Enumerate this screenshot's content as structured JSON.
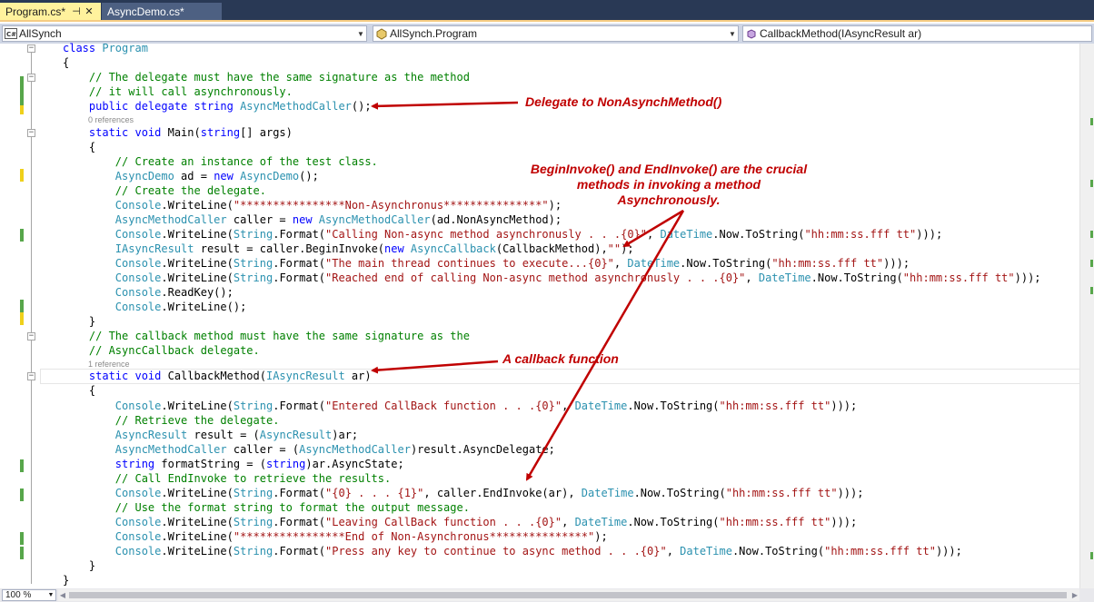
{
  "tabs": [
    {
      "label": "Program.cs*",
      "active": true
    },
    {
      "label": "AsyncDemo.cs*",
      "active": false
    }
  ],
  "nav": {
    "project": "AllSynch",
    "type": "AllSynch.Program",
    "member": "CallbackMethod(IAsyncResult ar)"
  },
  "code": {
    "l1": {
      "a": "class ",
      "b": "Program"
    },
    "l2": {
      "a": "{"
    },
    "l3": {
      "a": "    // The delegate must have the same signature as the method"
    },
    "l4": {
      "a": "    // it will call asynchronously."
    },
    "l5": {
      "a": "    public delegate string ",
      "b": "AsyncMethodCaller",
      "c": "();"
    },
    "r1": "0 references",
    "l6": {
      "a": "    static void ",
      "b": "Main(",
      "c": "string",
      "d": "[] args)"
    },
    "l7": {
      "a": "    {"
    },
    "l8": {
      "a": "        // Create an instance of the test class."
    },
    "l9": {
      "a": "        ",
      "b": "AsyncDemo",
      "c": " ad = ",
      "d": "new ",
      "e": "AsyncDemo",
      "f": "();"
    },
    "l10": {
      "a": "        // Create the delegate."
    },
    "l11": {
      "a": "        ",
      "b": "Console",
      "c": ".WriteLine(",
      "d": "\"****************Non-Asynchronus***************\"",
      "e": ");"
    },
    "l12": {
      "a": "        ",
      "b": "AsyncMethodCaller",
      "c": " caller = ",
      "d": "new ",
      "e": "AsyncMethodCaller",
      "f": "(ad.NonAsyncMethod);"
    },
    "l13": {
      "a": "        ",
      "b": "Console",
      "c": ".WriteLine(",
      "d": "String",
      "e": ".Format(",
      "f": "\"Calling Non-async method asynchronusly . . .{0}\"",
      "g": ", ",
      "h": "DateTime",
      "i": ".Now.ToString(",
      "j": "\"hh:mm:ss.fff tt\"",
      "k": ")));"
    },
    "l14": {
      "a": "        ",
      "b": "IAsyncResult",
      "c": " result = caller.BeginInvoke(",
      "d": "new ",
      "e": "AsyncCallback",
      "f": "(CallbackMethod),",
      "g": "\"\"",
      "h": ");"
    },
    "l15": {
      "a": "        ",
      "b": "Console",
      "c": ".WriteLine(",
      "d": "String",
      "e": ".Format(",
      "f": "\"The main thread continues to execute...{0}\"",
      "g": ", ",
      "h": "DateTime",
      "i": ".Now.ToString(",
      "j": "\"hh:mm:ss.fff tt\"",
      "k": ")));"
    },
    "l16": {
      "a": "        ",
      "b": "Console",
      "c": ".WriteLine(",
      "d": "String",
      "e": ".Format(",
      "f": "\"Reached end of calling Non-async method asynchronusly . . .{0}\"",
      "g": ", ",
      "h": "DateTime",
      "i": ".Now.ToString(",
      "j": "\"hh:mm:ss.fff tt\"",
      "k": ")));"
    },
    "l17": {
      "a": "        ",
      "b": "Console",
      "c": ".ReadKey();"
    },
    "l18": {
      "a": "        ",
      "b": "Console",
      "c": ".WriteLine();"
    },
    "l19": {
      "a": "    }"
    },
    "l20": {
      "a": "    // The callback method must have the same signature as the"
    },
    "l21": {
      "a": "    // AsyncCallback delegate."
    },
    "r2": "1 reference",
    "l22": {
      "a": "    static void ",
      "b": "CallbackMethod(",
      "c": "IAsyncResult",
      "d": " ar)"
    },
    "l23": {
      "a": "    {"
    },
    "l24": {
      "a": "        ",
      "b": "Console",
      "c": ".WriteLine(",
      "d": "String",
      "e": ".Format(",
      "f": "\"Entered CallBack function . . .{0}\"",
      "g": ", ",
      "h": "DateTime",
      "i": ".Now.ToString(",
      "j": "\"hh:mm:ss.fff tt\"",
      "k": ")));"
    },
    "l25": {
      "a": "        // Retrieve the delegate."
    },
    "l26": {
      "a": "        ",
      "b": "AsyncResult",
      "c": " result = (",
      "d": "AsyncResult",
      "e": ")ar;"
    },
    "l27": {
      "a": "        ",
      "b": "AsyncMethodCaller",
      "c": " caller = (",
      "d": "AsyncMethodCaller",
      "e": ")result.AsyncDelegate;"
    },
    "l28": {
      "a": "        ",
      "b": "string",
      "c": " formatString = (",
      "d": "string",
      "e": ")ar.AsyncState;"
    },
    "l29": {
      "a": "        // Call EndInvoke to retrieve the results."
    },
    "l30": {
      "a": "        ",
      "b": "Console",
      "c": ".WriteLine(",
      "d": "String",
      "e": ".Format(",
      "f": "\"{0} . . . {1}\"",
      "g": ", caller.EndInvoke(ar), ",
      "h": "DateTime",
      "i": ".Now.ToString(",
      "j": "\"hh:mm:ss.fff tt\"",
      "k": ")));"
    },
    "l31": {
      "a": "        // Use the format string to format the output message."
    },
    "l32": {
      "a": "        ",
      "b": "Console",
      "c": ".WriteLine(",
      "d": "String",
      "e": ".Format(",
      "f": "\"Leaving CallBack function . . .{0}\"",
      "g": ", ",
      "h": "DateTime",
      "i": ".Now.ToString(",
      "j": "\"hh:mm:ss.fff tt\"",
      "k": ")));"
    },
    "l33": {
      "a": "        ",
      "b": "Console",
      "c": ".WriteLine(",
      "d": "\"****************End of Non-Asynchronus***************\"",
      "e": ");"
    },
    "l34": {
      "a": "        ",
      "b": "Console",
      "c": ".WriteLine(",
      "d": "String",
      "e": ".Format(",
      "f": "\"Press any key to continue to async method . . .{0}\"",
      "g": ", ",
      "h": "DateTime",
      "i": ".Now.ToString(",
      "j": "\"hh:mm:ss.fff tt\"",
      "k": ")));"
    },
    "l35": {
      "a": "    }"
    },
    "l36": {
      "a": "}"
    }
  },
  "annotations": {
    "delegate": "Delegate to NonAsynchMethod()",
    "begin_line1": "BeginInvoke() and EndInvoke() are the crucial",
    "begin_line2": "methods in invoking a method",
    "begin_line3": "Asynchronously.",
    "callback": "A callback function"
  },
  "zoom": "100 %",
  "colors": {
    "keyword": "#0000ff",
    "type": "#2b91af",
    "comment": "#008000",
    "string": "#a31515",
    "annotation": "#c00000",
    "changed_saved": "#57a64a",
    "changed_unsaved": "#efd01b"
  }
}
